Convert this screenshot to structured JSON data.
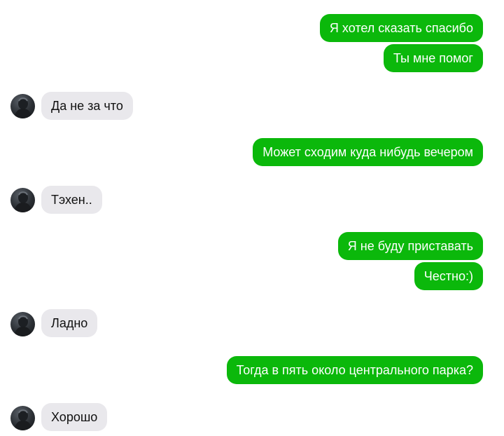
{
  "messages": [
    {
      "side": "out",
      "text": "Я хотел сказать спасибо"
    },
    {
      "side": "out",
      "text": "Ты мне помог"
    },
    {
      "side": "in",
      "text": "Да не за что"
    },
    {
      "side": "out",
      "text": "Может сходим куда нибудь вечером"
    },
    {
      "side": "in",
      "text": "Тэхен.."
    },
    {
      "side": "out",
      "text": "Я не буду приставать"
    },
    {
      "side": "out",
      "text": "Честно:)"
    },
    {
      "side": "in",
      "text": "Ладно"
    },
    {
      "side": "out",
      "text": "Тогда в пять около центрального парка?"
    },
    {
      "side": "in",
      "text": "Хорошо"
    }
  ],
  "colors": {
    "outgoing_bubble": "#0bb80b",
    "incoming_bubble": "#e9e8ec",
    "background": "#ffffff"
  },
  "icons": {
    "avatar": "contact-avatar-icon"
  }
}
